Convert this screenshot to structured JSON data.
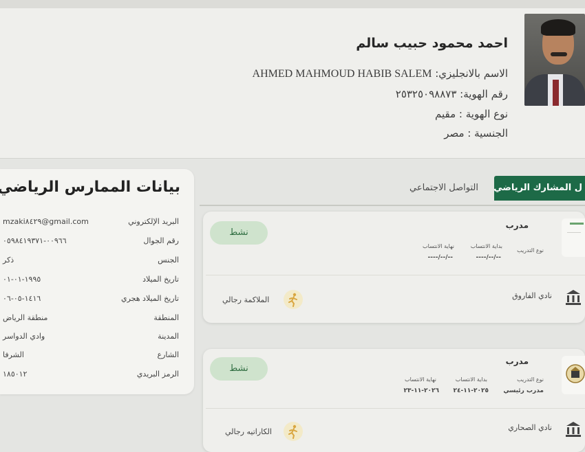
{
  "profile": {
    "name_ar": "احمد محمود حبيب سالم",
    "english_name_label": "الاسم بالانجليزي:",
    "english_name": "AHMED MAHMOUD HABIB SALEM",
    "id_number": "رقم الهوية: ٢٥٣٢٥٠٩٨٨٧٣",
    "id_type": "نوع الهوية : مقيم",
    "nationality": "الجنسية : مصر"
  },
  "practitioner": {
    "title": "بيانات الممارس الرياضي",
    "fields": [
      {
        "label": "البريد الإلكتروني",
        "value": "mzaki٨٤٢٩@gmail.com"
      },
      {
        "label": "رقم الجوال",
        "value": "٠٠٩٦٦-٠٥٩٨٤١٩٣٧١"
      },
      {
        "label": "الجنس",
        "value": "ذكر"
      },
      {
        "label": "تاريخ الميلاد",
        "value": "١٩٩٥-٠١-٠١"
      },
      {
        "label": "تاريخ الميلاد هجري",
        "value": "١٤١٦-٠٥-٠٦"
      },
      {
        "label": "المنطقة",
        "value": "منطقة الرياض"
      },
      {
        "label": "المدينة",
        "value": "وادي الدواسر"
      },
      {
        "label": "الشارع",
        "value": "الشرفا"
      },
      {
        "label": "الرمز البريدي",
        "value": "١٨٥٠١٢"
      }
    ]
  },
  "tabs": [
    {
      "label": "ل المشارك الرياضي",
      "active": true
    },
    {
      "label": "التواصل الاجتماعي",
      "active": false
    }
  ],
  "registrations": [
    {
      "role": "مدرب",
      "status": "نشط",
      "training_type_label": "نوع التدريب",
      "training_type": "",
      "start_label": "بداية الانتساب",
      "start": "----/--/--",
      "end_label": "نهاية الانتساب",
      "end": "----/--/--",
      "club": "نادي الفاروق",
      "sport": "الملاكمة رجالي"
    },
    {
      "role": "مدرب",
      "status": "نشط",
      "training_type_label": "نوع التدريب",
      "training_type": "مدرب رئيسي",
      "start_label": "بداية الانتساب",
      "start": "٢٠٢٥-١١-٢٤",
      "end_label": "نهاية الانتساب",
      "end": "٢٠٢٦-١١-٢٣",
      "club": "نادي الصحاري",
      "sport": "الكاراتيه رجالي"
    }
  ],
  "colors": {
    "accent": "#1d6a47",
    "badge_bg": "#cfe3cd",
    "badge_text": "#2d6c3f",
    "sport_circle": "#f3eac8"
  },
  "icons": [
    "stadium-icon",
    "running-figure-icon",
    "club-logo-icon"
  ]
}
